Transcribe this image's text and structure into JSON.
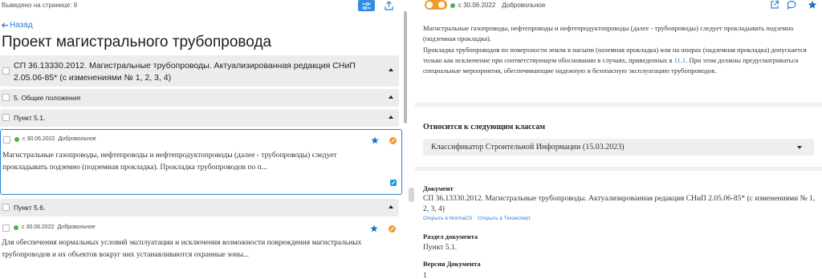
{
  "left": {
    "count_text": "Выведено на странице: 9",
    "back_label": "Назад",
    "title": "Проект магистрального трубопровода",
    "document_title": "СП 36.13330.2012. Магистральные трубопроводы. Актуализированная редакция СНиП 2.05.06-85* (с изменениями № 1, 2, 3, 4)",
    "section_label": "5. Общие положения",
    "item1_label": "Пункт 5.1.",
    "card1": {
      "date": "с 30.06.2022",
      "status": "Добровольное",
      "text": "Магистральные газопроводы, нефтепроводы и нефтепродуктопроводы (далее - трубопроводы) следует прокладывать подземно (подземная прокладка). Прокладка трубопроводов по п..."
    },
    "item2_label": "Пункт 5.6.",
    "card2": {
      "date": "с 30.06.2022",
      "status": "Добровольное",
      "text": "Для обеспечения нормальных условий эксплуатации и исключения возможности повреждения магистральных трубопроводов и их объектов вокруг них устанавливаются охранные зоны..."
    }
  },
  "right": {
    "date": "с 30.06.2022",
    "status": "Добровольное",
    "para1": "Магистральные газопроводы, нефтепроводы и нефтепродуктопроводы (далее - трубопроводы) следует прокладывать подземно (подземная прокладка).",
    "para2_before": "Прокладка трубопроводов по поверхности земли в насыпи (наземная прокладка) или на опорах (надземная прокладка) допускается только как исключение при соответствующем обосновании в случаях, приведенных в ",
    "para2_link": "11.1",
    "para2_after": ". При этом должны предусматриваться специальные мероприятия, обеспечивающие надежную и безопасную эксплуатацию трубопроводов.",
    "classes_heading": "Относится к следующим классам",
    "classes_selected": "Классификатор Строительной Информации (15.03.2023)",
    "document_label": "Документ",
    "document_value": "СП 36.13330.2012. Магистральные трубопроводы. Актуализированная редакция СНиП 2.05.06-85* (с изменениями № 1, 2, 3, 4)",
    "open_normacs": "Открыть в NormaCS",
    "open_techexpert": "Открыть в Техэксперт",
    "section_label": "Раздел документа",
    "section_value": "Пункт 5.1.",
    "version_label": "Версия Документа",
    "version_value": "1"
  },
  "colors": {
    "accent": "#2f8de4",
    "link": "#2f7fd2",
    "status_green": "#4fb24b",
    "orange": "#f09a2e"
  }
}
